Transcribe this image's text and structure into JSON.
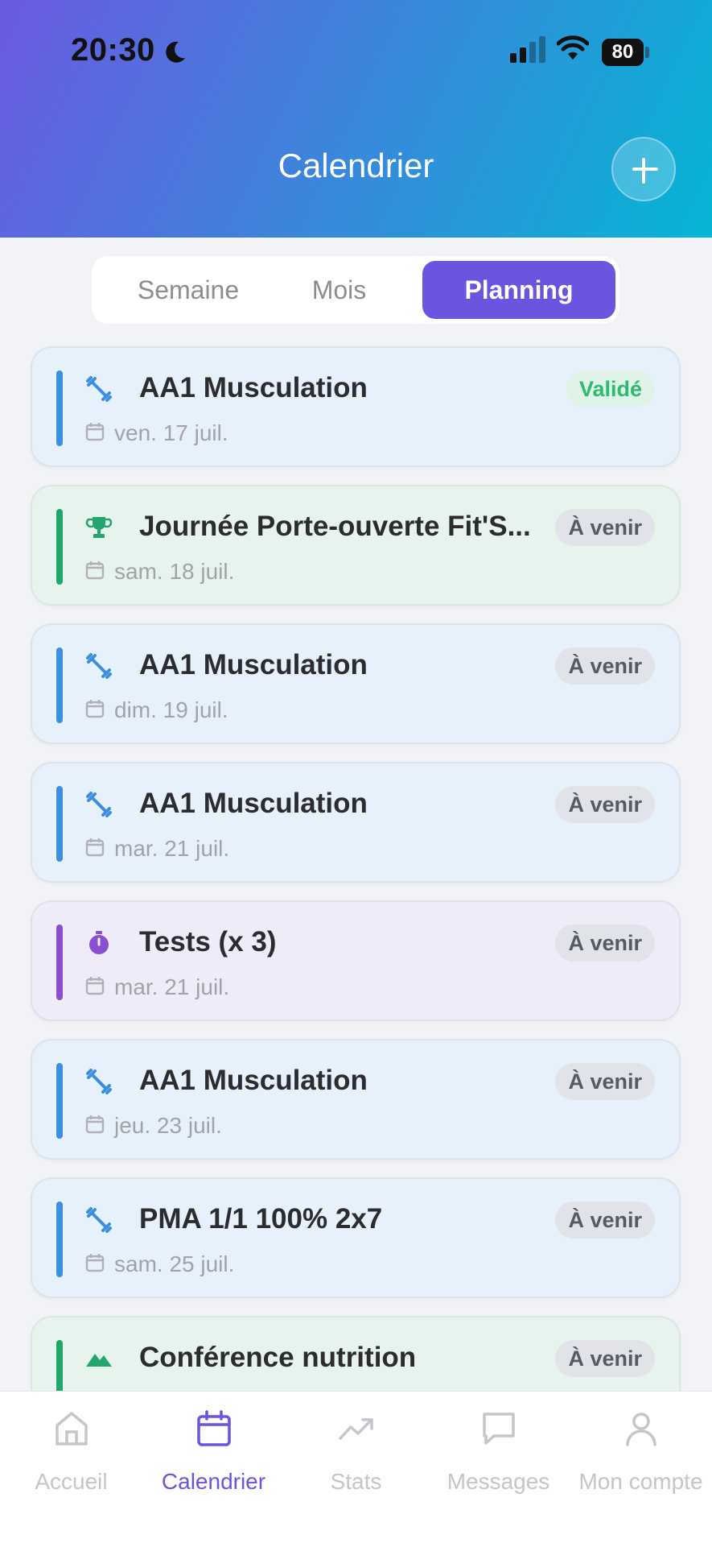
{
  "status_bar": {
    "time": "20:30",
    "battery": "80"
  },
  "header": {
    "title": "Calendrier"
  },
  "segments": [
    "Semaine",
    "Mois",
    "Planning"
  ],
  "active_segment": "Planning",
  "events": [
    {
      "title": "AA1 Musculation",
      "date": "ven. 17 juil.",
      "status": "Validé",
      "category": "musculation",
      "icon": "dumbbell-icon"
    },
    {
      "title": "Journée Porte-ouverte Fit'S...",
      "date": "sam. 18 juil.",
      "status": "À venir",
      "category": "evenement",
      "icon": "trophy-icon"
    },
    {
      "title": "AA1 Musculation",
      "date": "dim. 19 juil.",
      "status": "À venir",
      "category": "musculation",
      "icon": "dumbbell-icon"
    },
    {
      "title": "AA1 Musculation",
      "date": "mar. 21 juil.",
      "status": "À venir",
      "category": "musculation",
      "icon": "dumbbell-icon"
    },
    {
      "title": "Tests (x 3)",
      "date": "mar. 21 juil.",
      "status": "À venir",
      "category": "tests",
      "icon": "stopwatch-icon"
    },
    {
      "title": "AA1 Musculation",
      "date": "jeu. 23 juil.",
      "status": "À venir",
      "category": "musculation",
      "icon": "dumbbell-icon"
    },
    {
      "title": "PMA 1/1 100% 2x7",
      "date": "sam. 25 juil.",
      "status": "À venir",
      "category": "musculation",
      "icon": "dumbbell-icon"
    },
    {
      "title": "Conférence nutrition",
      "date": "",
      "status": "À venir",
      "category": "evenement",
      "icon": "mountain-icon"
    }
  ],
  "tabbar": {
    "items": [
      {
        "label": "Accueil",
        "icon": "home-icon"
      },
      {
        "label": "Calendrier",
        "icon": "calendar-icon"
      },
      {
        "label": "Stats",
        "icon": "trend-icon"
      },
      {
        "label": "Messages",
        "icon": "message-icon"
      },
      {
        "label": "Mon compte",
        "icon": "user-icon"
      }
    ],
    "active": "Calendrier"
  },
  "colors": {
    "accent": "#6c54e0",
    "musculation": "#3c8ede",
    "evenement": "#23a56e",
    "tests": "#8a4fd0",
    "validated": "#2cbc6e"
  }
}
